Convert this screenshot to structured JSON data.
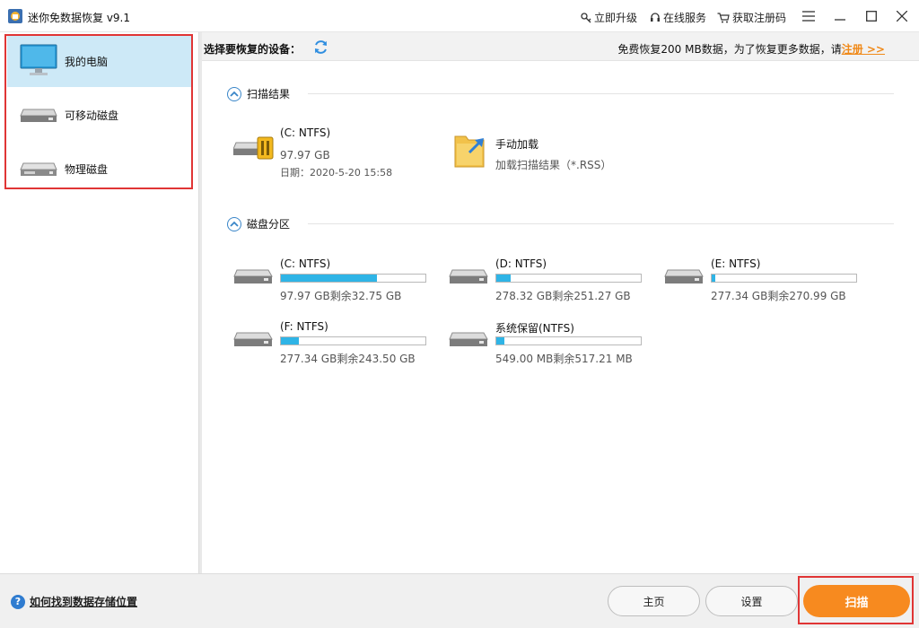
{
  "app": {
    "title": "迷你免数据恢复 v9.1"
  },
  "titlebar": {
    "upgrade": "立即升级",
    "service": "在线服务",
    "register": "获取注册码"
  },
  "sidebar": {
    "items": [
      {
        "label": "我的电脑",
        "icon": "monitor-icon",
        "active": true
      },
      {
        "label": "可移动磁盘",
        "icon": "removable-disk-icon"
      },
      {
        "label": "物理磁盘",
        "icon": "physical-disk-icon"
      }
    ]
  },
  "header": {
    "select_label": "选择要恢复的设备：",
    "promo_text": "免费恢复200 MB数据，为了恢复更多数据，请",
    "promo_link": "注册 >>"
  },
  "scan_results": {
    "title": "扫描结果",
    "last_scan": {
      "name": "(C: NTFS)",
      "size": "97.97 GB",
      "date": "日期：2020-5-20 15:58"
    },
    "manual_load": {
      "title": "手动加载",
      "subtitle": "加载扫描结果（*.RSS）"
    }
  },
  "partitions": {
    "title": "磁盘分区",
    "items": [
      {
        "name": "(C: NTFS)",
        "caption": "97.97 GB剩余32.75 GB",
        "used_fraction": 0.666
      },
      {
        "name": "(D: NTFS)",
        "caption": "278.32 GB剩余251.27 GB",
        "used_fraction": 0.097
      },
      {
        "name": "(E: NTFS)",
        "caption": "277.34 GB剩余270.99 GB",
        "used_fraction": 0.023
      },
      {
        "name": "(F: NTFS)",
        "caption": "277.34 GB剩余243.50 GB",
        "used_fraction": 0.122
      },
      {
        "name": "系统保留(NTFS)",
        "caption": "549.00 MB剩余517.21 MB",
        "used_fraction": 0.058
      }
    ]
  },
  "footer": {
    "help_text": "如何找到数据存储位置",
    "home_label": "主页",
    "settings_label": "设置",
    "scan_label": "扫描"
  },
  "colors": {
    "accent": "#2fb4e6",
    "scan_button": "#f78a1f",
    "promo_link": "#f08a1a",
    "sidebar_active": "#cde9f7",
    "highlight_box": "#e03535"
  }
}
